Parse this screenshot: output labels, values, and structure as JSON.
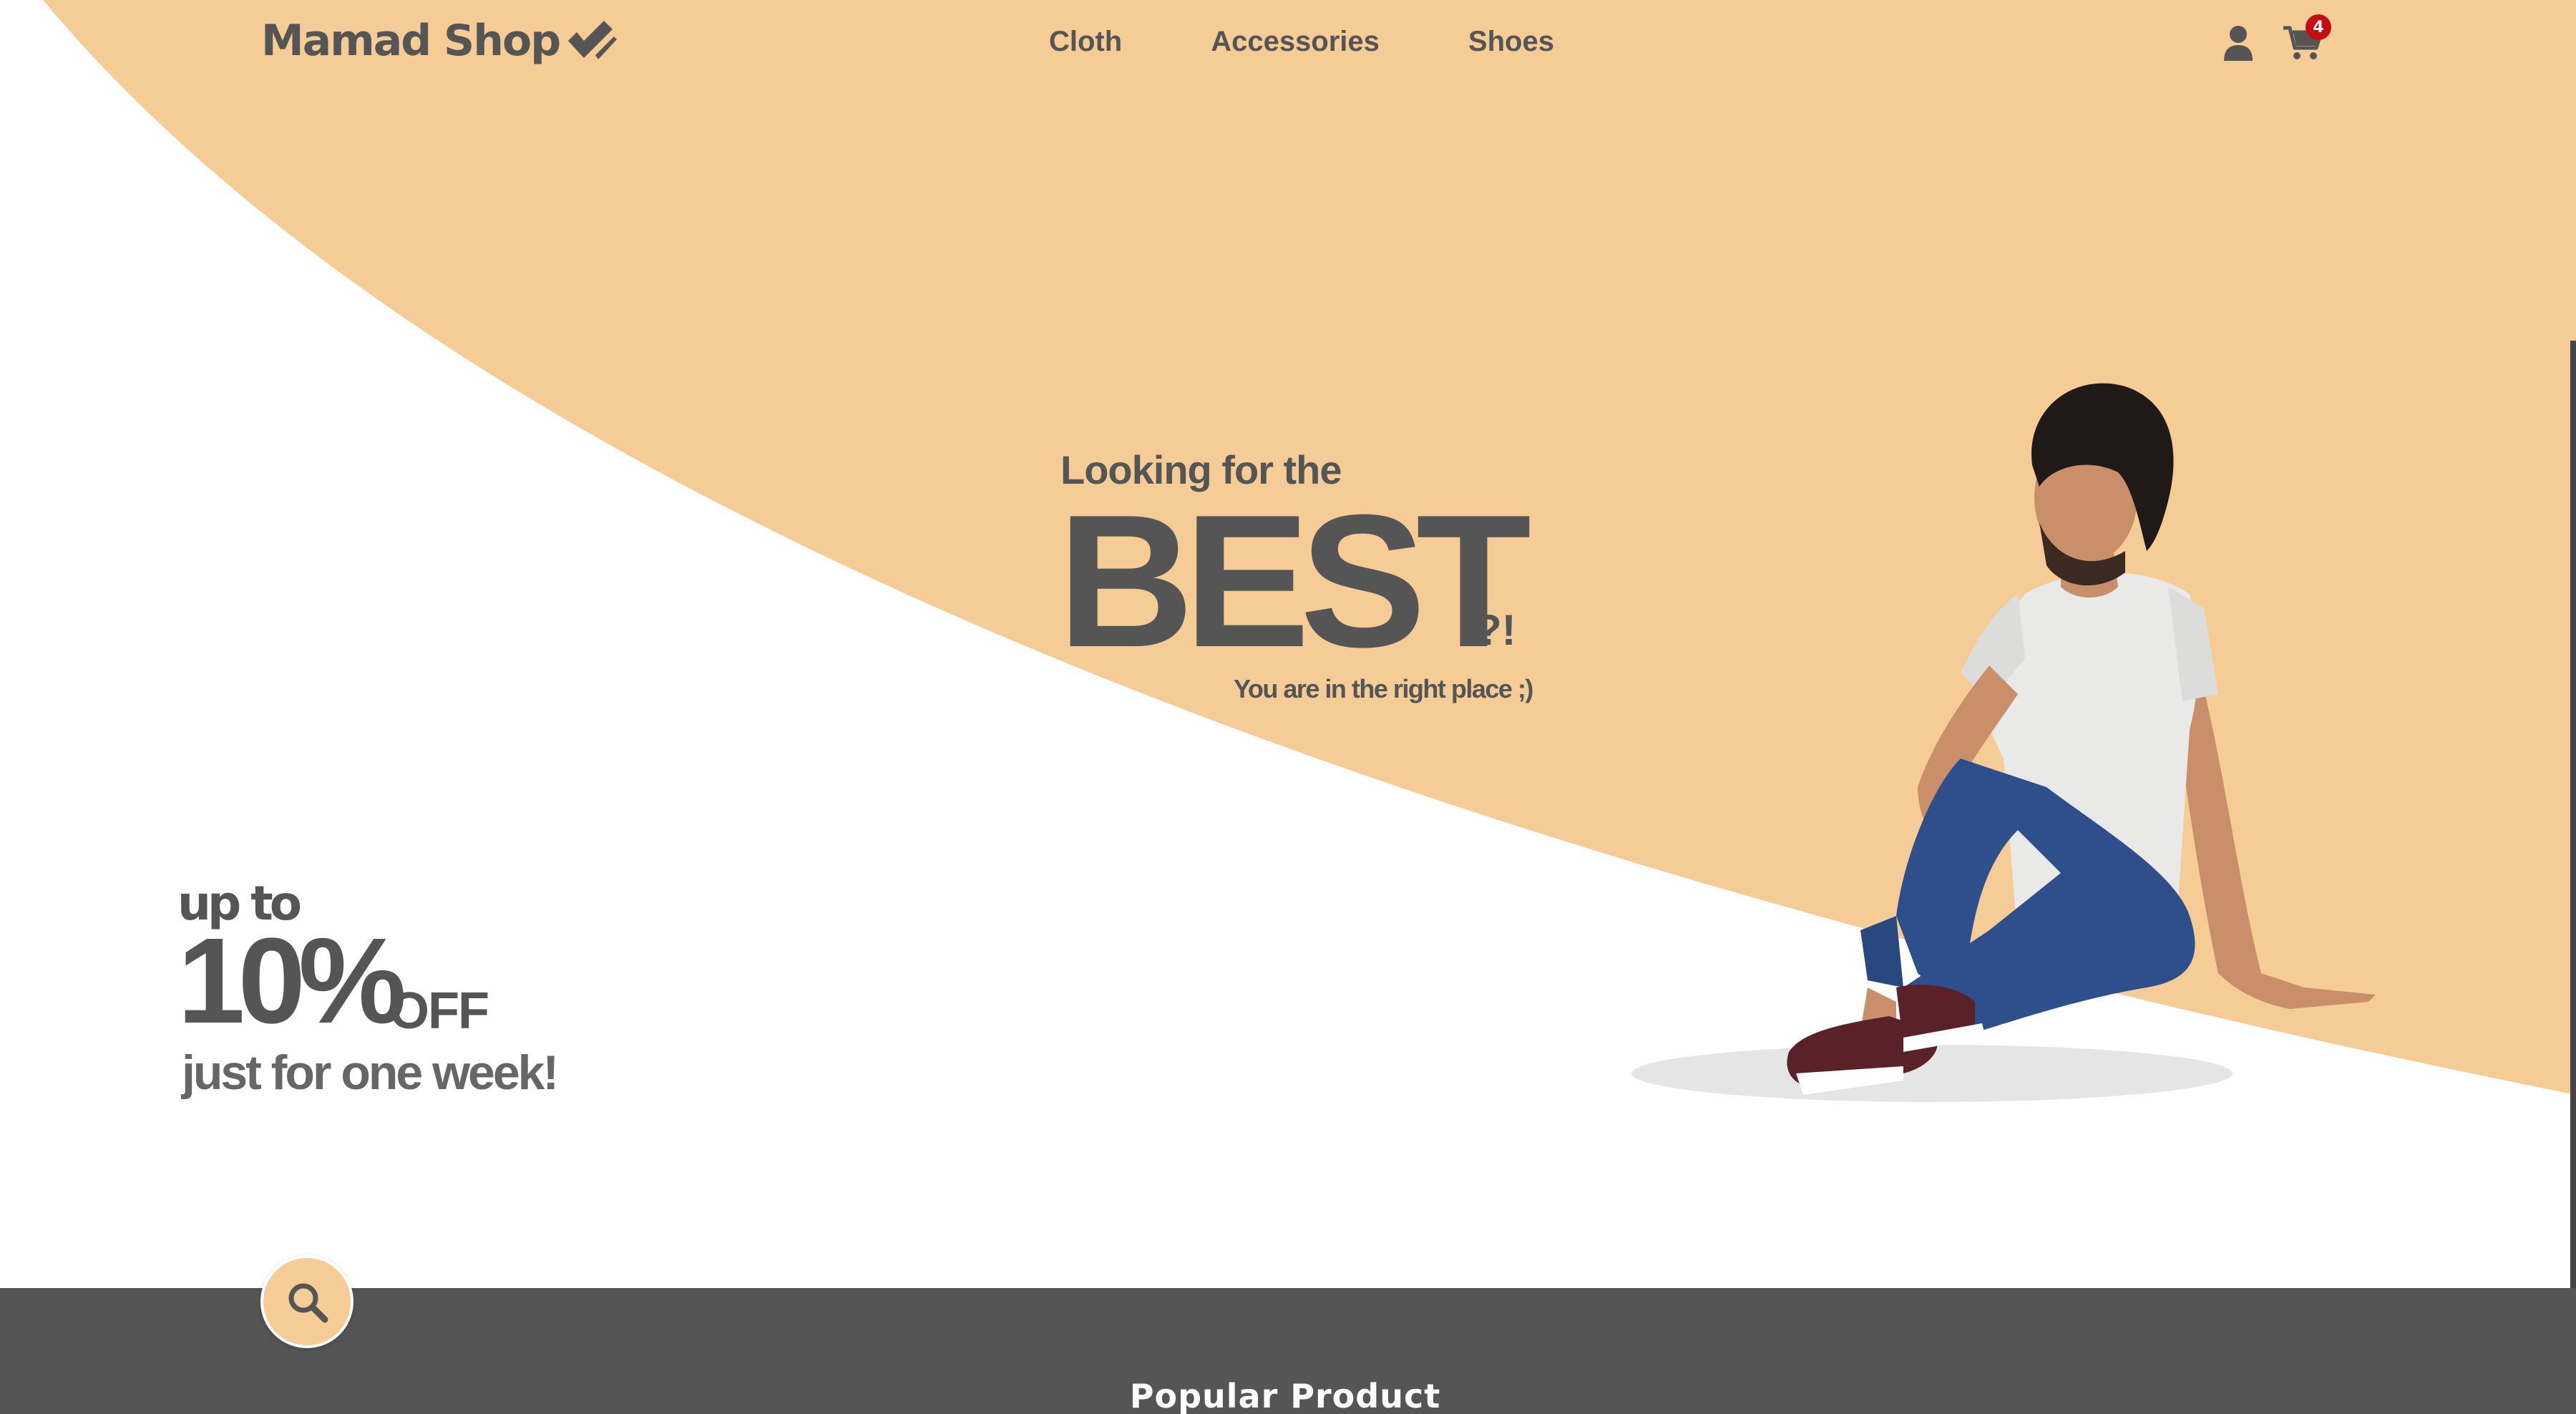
{
  "brand": {
    "name": "Mamad Shop",
    "logo_icon": "double-check-icon"
  },
  "nav": {
    "items": [
      {
        "label": "Cloth"
      },
      {
        "label": "Accessories"
      },
      {
        "label": "Shoes"
      }
    ]
  },
  "header_icons": {
    "user_icon": "user-icon",
    "cart_icon": "shopping-cart-icon",
    "cart_count": "4"
  },
  "hero": {
    "kicker": "Looking  for the",
    "headline": "BEST",
    "punctuation": "?!",
    "subline": "You are in the right place ;)"
  },
  "promo": {
    "up_to": "up to",
    "percent": "10%",
    "off": "OFF",
    "duration": "just for one week!"
  },
  "search": {
    "icon": "search-icon"
  },
  "popular": {
    "title": "Popular Product"
  },
  "colors": {
    "accent": "#f5cc96",
    "text": "#555555",
    "dark_section": "#555555",
    "badge": "#c40d12",
    "background": "#ffffff"
  }
}
